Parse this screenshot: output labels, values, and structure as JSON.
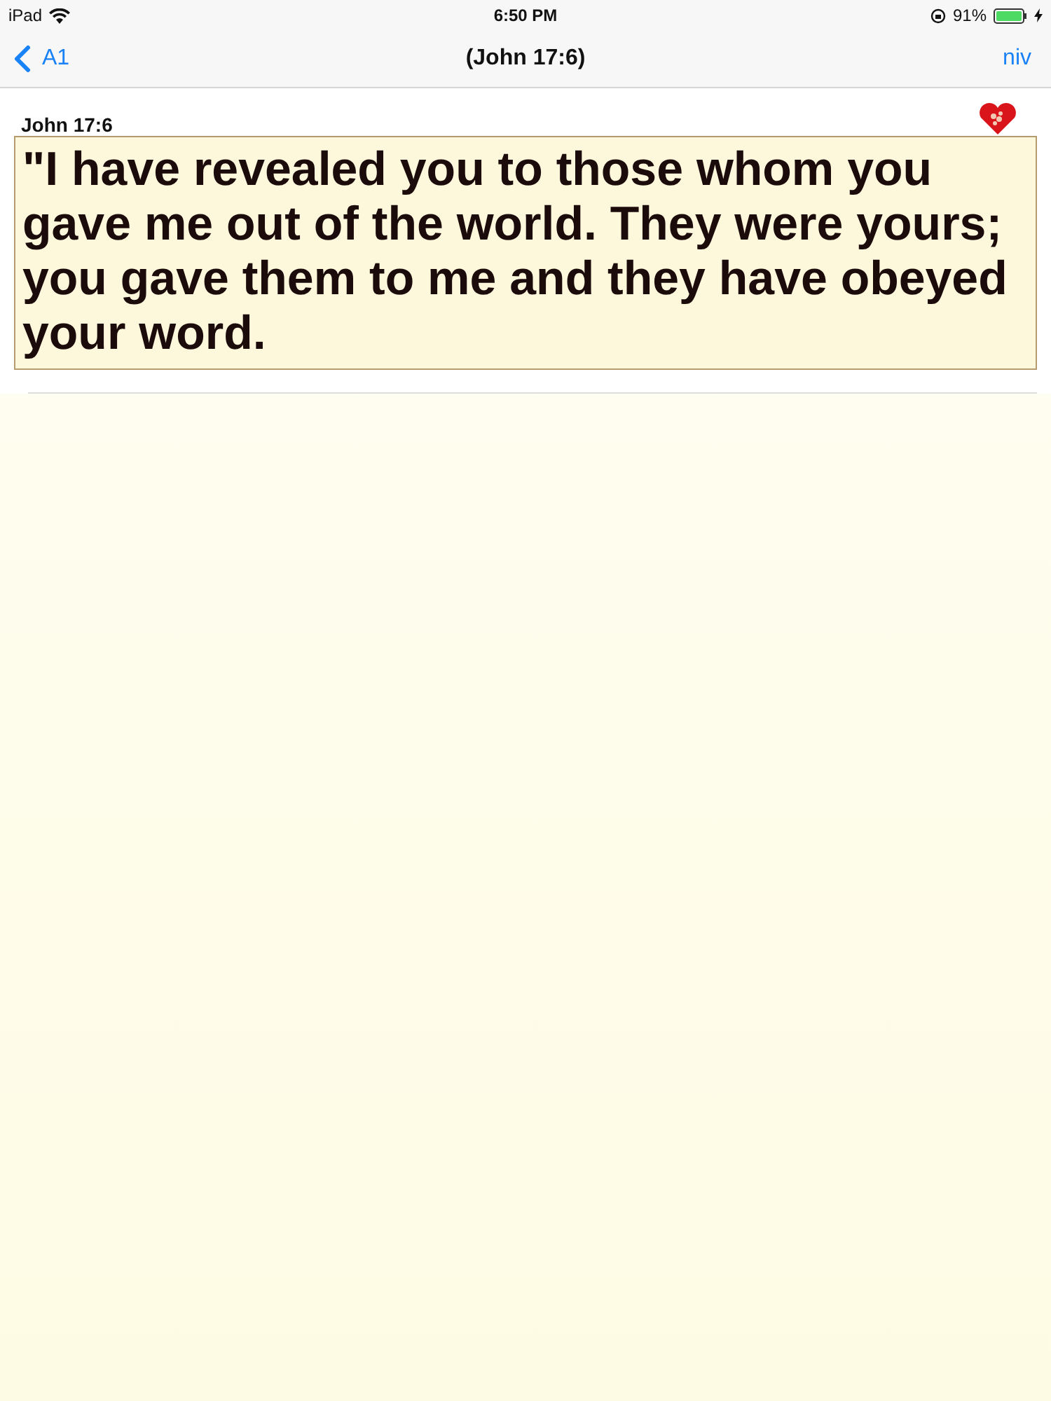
{
  "status_bar": {
    "device": "iPad",
    "time": "6:50 PM",
    "battery": "91%",
    "charging": true
  },
  "nav_bar": {
    "back": "A1",
    "title": "(John 17:6)",
    "action": "niv"
  },
  "verse": {
    "reference": "John 17:6",
    "favorite": true,
    "text": "\"I have revealed you to those whom you gave me out of the world. They were yours; you gave them to me and they have obeyed your word."
  }
}
